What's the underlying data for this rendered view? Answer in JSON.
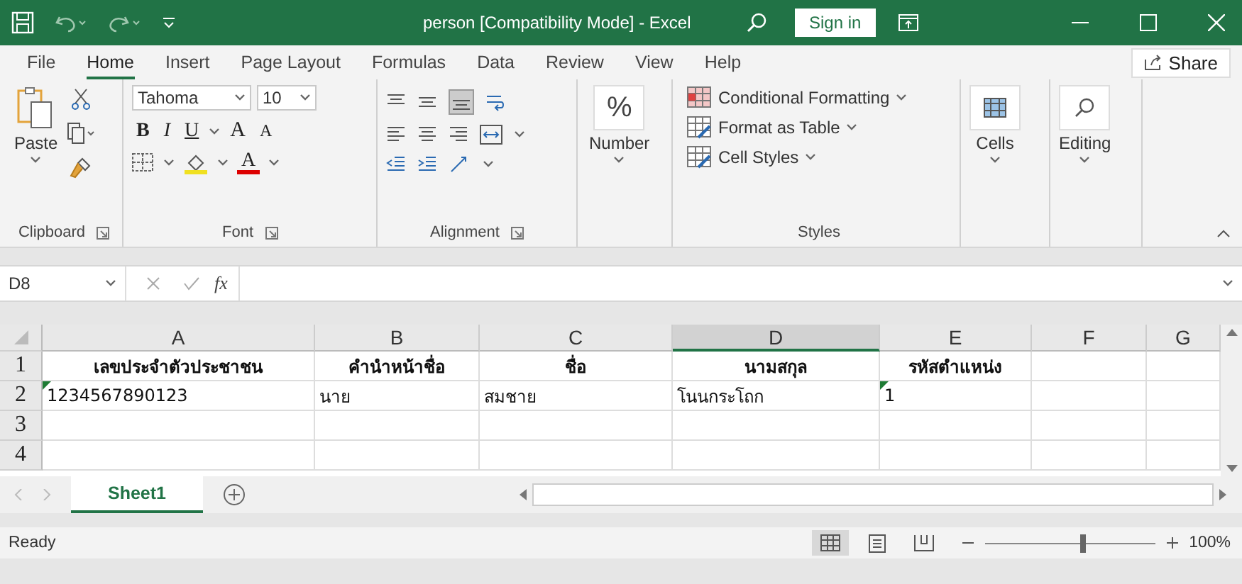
{
  "title_bar": {
    "title": "person  [Compatibility Mode]  -  Excel",
    "sign_in": "Sign in"
  },
  "ribbon_tabs": [
    {
      "label": "File",
      "selected": false
    },
    {
      "label": "Home",
      "selected": true
    },
    {
      "label": "Insert",
      "selected": false
    },
    {
      "label": "Page Layout",
      "selected": false
    },
    {
      "label": "Formulas",
      "selected": false
    },
    {
      "label": "Data",
      "selected": false
    },
    {
      "label": "Review",
      "selected": false
    },
    {
      "label": "View",
      "selected": false
    },
    {
      "label": "Help",
      "selected": false
    }
  ],
  "share": "Share",
  "ribbon": {
    "clipboard": {
      "paste": "Paste",
      "label": "Clipboard"
    },
    "font": {
      "font_name": "Tahoma",
      "font_size": "10",
      "format_buttons": [
        {
          "kind": "bold",
          "label": "B"
        },
        {
          "kind": "italic",
          "label": "I"
        },
        {
          "kind": "underline",
          "label": "U"
        }
      ],
      "size_buttons": [
        {
          "kind": "grow",
          "label": "A"
        },
        {
          "kind": "shrink",
          "label": "A"
        }
      ],
      "font_color": "A",
      "label": "Font"
    },
    "alignment": {
      "label": "Alignment"
    },
    "number": {
      "symbol": "%",
      "label": "Number"
    },
    "styles": {
      "items": [
        "Conditional Formatting",
        "Format as Table",
        "Cell Styles"
      ],
      "label": "Styles"
    },
    "cells": {
      "label": "Cells"
    },
    "editing": {
      "label": "Editing"
    }
  },
  "formula_bar": {
    "name_box": "D8",
    "fx": "fx"
  },
  "grid": {
    "columns": [
      {
        "label": "A",
        "selected": false
      },
      {
        "label": "B",
        "selected": false
      },
      {
        "label": "C",
        "selected": false
      },
      {
        "label": "D",
        "selected": true
      },
      {
        "label": "E",
        "selected": false
      },
      {
        "label": "F",
        "selected": false
      },
      {
        "label": "G",
        "selected": false
      }
    ],
    "rows": [
      {
        "number": "1",
        "kind": "header",
        "cells": [
          {
            "text": "เลขประจำตัวประชาชน",
            "marker": false
          },
          {
            "text": "คำนำหน้าชื่อ",
            "marker": false
          },
          {
            "text": "ชื่อ",
            "marker": false
          },
          {
            "text": "นามสกุล",
            "marker": false
          },
          {
            "text": "รหัสตำแหน่ง",
            "marker": false
          }
        ]
      },
      {
        "number": "2",
        "kind": "data",
        "cells": [
          {
            "text": "1234567890123",
            "marker": true
          },
          {
            "text": "นาย",
            "marker": false
          },
          {
            "text": "สมชาย",
            "marker": false
          },
          {
            "text": "โนนกระโถก",
            "marker": false
          },
          {
            "text": "1",
            "marker": true
          }
        ]
      },
      {
        "number": "3",
        "kind": "data",
        "cells": []
      },
      {
        "number": "4",
        "kind": "data",
        "cells": []
      }
    ]
  },
  "sheet_tabs": [
    {
      "label": "Sheet1",
      "selected": true
    }
  ],
  "status_bar": {
    "status": "Ready",
    "views": [
      {
        "kind": "normal",
        "selected": true
      },
      {
        "kind": "page_layout",
        "selected": false
      },
      {
        "kind": "page_break",
        "selected": false
      }
    ],
    "zoom": {
      "level": 0.58,
      "label": "100%"
    }
  }
}
